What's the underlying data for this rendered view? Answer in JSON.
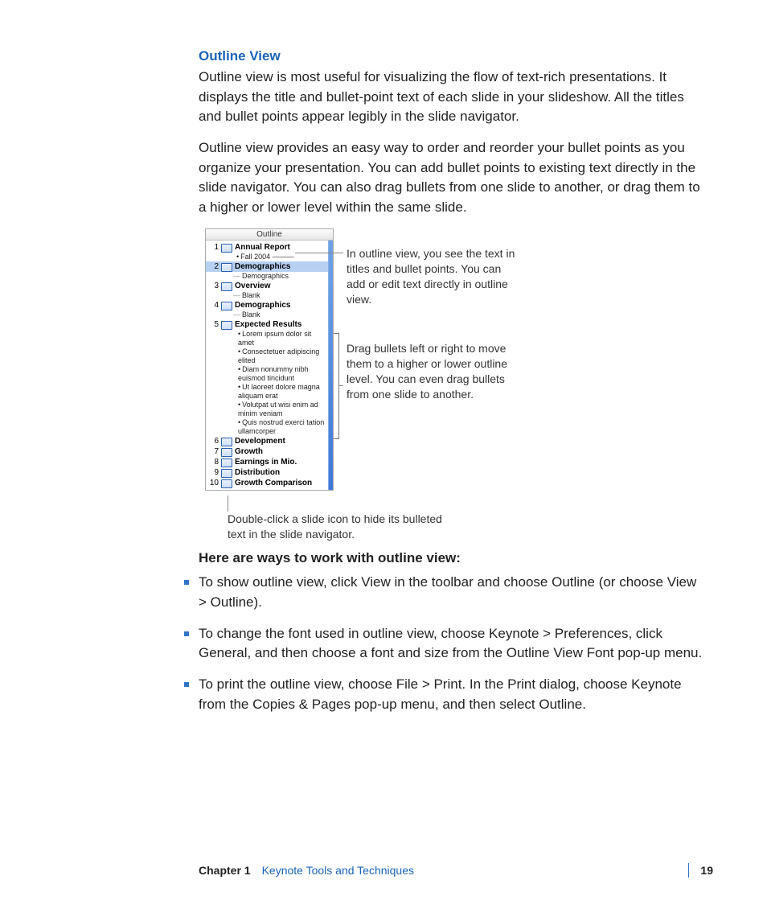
{
  "section": {
    "title": "Outline View",
    "para1": "Outline view is most useful for visualizing the flow of text-rich presentations. It displays the title and bullet-point text of each slide in your slideshow. All the titles and bullet points appear legibly in the slide navigator.",
    "para2": "Outline view provides an easy way to order and reorder your bullet points as you organize your presentation. You can add bullet points to existing text directly in the slide navigator. You can also drag bullets from one slide to another, or drag them to a higher or lower level within the same slide."
  },
  "outline_panel": {
    "header": "Outline",
    "slides": [
      {
        "n": "1",
        "title": "Annual Report",
        "sub_fall": "Fall 2004",
        "selected": false
      },
      {
        "n": "2",
        "title": "Demographics",
        "sub_dash": "Demographics",
        "selected": true
      },
      {
        "n": "3",
        "title": "Overview",
        "sub_dash": "Blank",
        "selected": false
      },
      {
        "n": "4",
        "title": "Demographics",
        "sub_dash": "Blank",
        "selected": false
      },
      {
        "n": "5",
        "title": "Expected Results",
        "bullets": [
          "Lorem ipsum dolor sit amet",
          "Consectetuer adipiscing elited",
          "Diam nonummy nibh euismod tincidunt",
          "Ut laoreet dolore magna aliquam erat",
          "Volutpat ut wisi enim ad minim veniam",
          "Quis nostrud exerci tation ullamcorper"
        ],
        "selected": false
      },
      {
        "n": "6",
        "title": "Development",
        "selected": false
      },
      {
        "n": "7",
        "title": "Growth",
        "selected": false
      },
      {
        "n": "8",
        "title": "Earnings in Mio.",
        "selected": false
      },
      {
        "n": "9",
        "title": "Distribution",
        "selected": false
      },
      {
        "n": "10",
        "title": "Growth Comparison",
        "selected": false
      }
    ]
  },
  "callouts": {
    "c1": "In outline view, you see the text in titles and bullet points. You can add or edit text directly in outline view.",
    "c2": "Drag bullets left or right to move them to a higher or lower outline level. You can even drag bullets from one slide to another.",
    "c3": "Double-click a slide icon to hide its bulleted text in the slide navigator."
  },
  "ways": {
    "heading": "Here are ways to work with outline view:",
    "items": [
      "To show outline view, click View in the toolbar and choose Outline (or choose View > Outline).",
      "To change the font used in outline view, choose Keynote > Preferences, click General, and then choose a font and size from the Outline View Font pop-up menu.",
      "To print the outline view, choose File > Print. In the Print dialog, choose Keynote from the Copies & Pages pop-up menu, and then select Outline."
    ]
  },
  "footer": {
    "chapter_label": "Chapter 1",
    "chapter_title": "Keynote Tools and Techniques",
    "page": "19"
  }
}
